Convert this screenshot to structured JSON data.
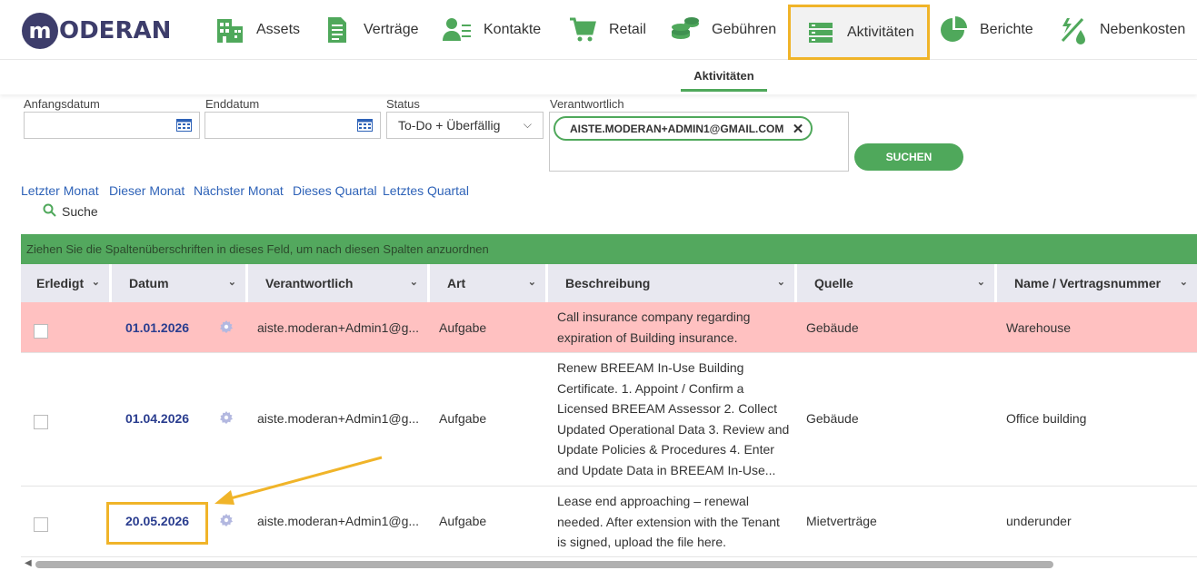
{
  "brand": {
    "logo_letter": "m",
    "logo_text": "ODERAN",
    "brand_color": "#3d3d6b"
  },
  "nav": [
    {
      "label": "Assets",
      "icon": "building-icon"
    },
    {
      "label": "Verträge",
      "icon": "document-icon"
    },
    {
      "label": "Kontakte",
      "icon": "contacts-icon"
    },
    {
      "label": "Retail",
      "icon": "cart-icon"
    },
    {
      "label": "Gebühren",
      "icon": "coins-icon"
    },
    {
      "label": "Aktivitäten",
      "icon": "activities-icon",
      "active": true
    },
    {
      "label": "Berichte",
      "icon": "pie-chart-icon"
    },
    {
      "label": "Nebenkosten",
      "icon": "utilities-icon"
    }
  ],
  "subnav": {
    "active_tab": "Aktivitäten"
  },
  "filters": {
    "start_label": "Anfangsdatum",
    "start_value": "",
    "end_label": "Enddatum",
    "end_value": "",
    "status_label": "Status",
    "status_value": "To-Do + Überfällig",
    "resp_label": "Verantwortlich",
    "resp_chip": "AISTE.MODERAN+ADMIN1@GMAIL.COM",
    "search_button": "SUCHEN"
  },
  "quick_ranges": [
    "Letzter Monat",
    "Dieser Monat",
    "Nächster Monat",
    "Dieses Quartal",
    "Letztes Quartal"
  ],
  "search_toggle": "Suche",
  "group_hint": "Ziehen Sie die Spaltenüberschriften in dieses Feld, um nach diesen Spalten anzuordnen",
  "columns": [
    "Erledigt",
    "Datum",
    "Verantwortlich",
    "Art",
    "Beschreibung",
    "Quelle",
    "Name / Vertragsnummer"
  ],
  "rows": [
    {
      "done": false,
      "date": "01.01.2026",
      "resp": "aiste.moderan+Admin1@g...",
      "art": "Aufgabe",
      "desc_lines": [
        "Call insurance company regarding",
        "expiration of Building insurance."
      ],
      "quelle": "Gebäude",
      "name": "Warehouse",
      "overdue": true
    },
    {
      "done": false,
      "date": "01.04.2026",
      "resp": "aiste.moderan+Admin1@g...",
      "art": "Aufgabe",
      "desc_lines": [
        "Renew BREEAM In-Use Building",
        "Certificate. 1. Appoint / Confirm a",
        "Licensed BREEAM Assessor 2. Collect",
        "Updated Operational Data 3. Review and",
        "Update Policies & Procedures 4. Enter",
        "and Update Data in BREEAM In-Use..."
      ],
      "quelle": "Gebäude",
      "name": "Office building",
      "overdue": false
    },
    {
      "done": false,
      "date": "20.05.2026",
      "resp": "aiste.moderan+Admin1@g...",
      "art": "Aufgabe",
      "desc_lines": [
        "Lease end approaching – renewal",
        "needed. After extension with the Tenant",
        "is signed, upload the file here."
      ],
      "quelle": "Mietverträge",
      "name": "underunder",
      "overdue": false
    }
  ],
  "colors": {
    "accent_green": "#4fa85b",
    "overdue_row": "#ffc1c1",
    "highlight": "#f0b429",
    "date_link": "#2a3d8f"
  }
}
